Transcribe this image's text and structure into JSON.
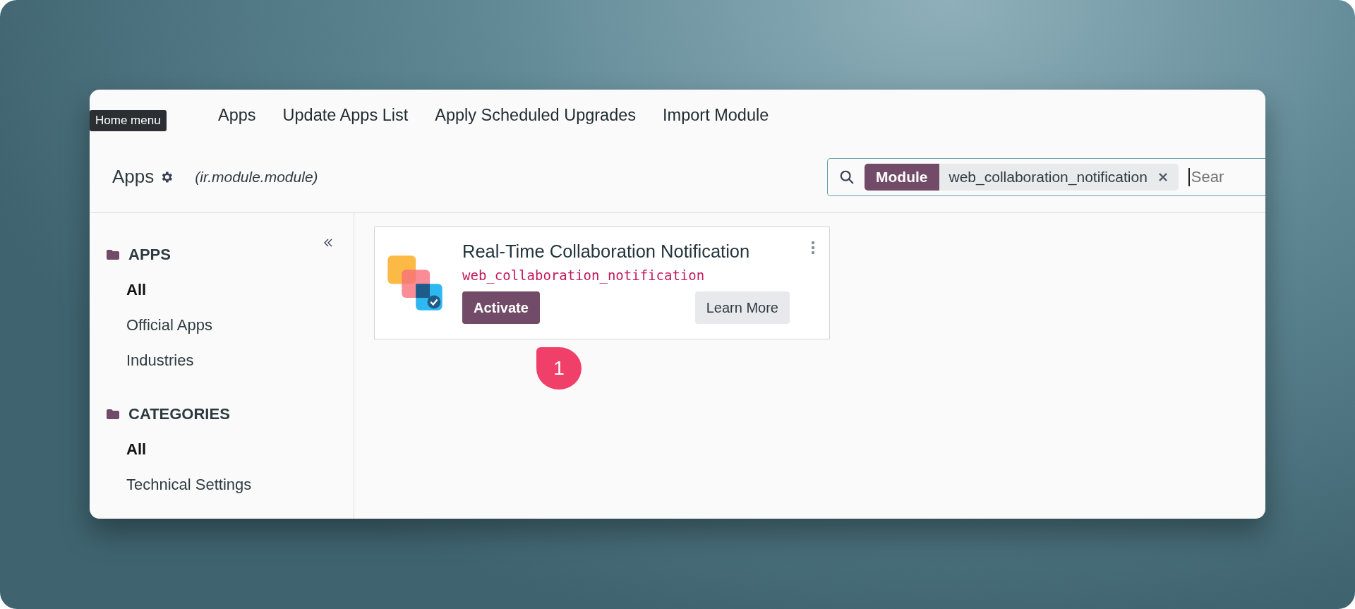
{
  "tooltip": "Home menu",
  "menu": [
    "Apps",
    "Update Apps List",
    "Apply Scheduled Upgrades",
    "Import Module"
  ],
  "breadcrumb": {
    "title": "Apps",
    "model": "(ir.module.module)"
  },
  "search": {
    "facet_label": "Module",
    "facet_value": "web_collaboration_notification",
    "placeholder": "Sear"
  },
  "sidebar": {
    "sections": [
      {
        "title": "APPS",
        "items": [
          {
            "label": "All",
            "selected": true
          },
          {
            "label": "Official Apps",
            "selected": false
          },
          {
            "label": "Industries",
            "selected": false
          }
        ]
      },
      {
        "title": "CATEGORIES",
        "items": [
          {
            "label": "All",
            "selected": true
          },
          {
            "label": "Technical Settings",
            "selected": false
          }
        ]
      }
    ]
  },
  "modules": [
    {
      "name": "Real-Time Collaboration Notification",
      "technical_name": "web_collaboration_notification",
      "buttons": [
        {
          "label": "Activate",
          "kind": "primary"
        },
        {
          "label": "Learn More",
          "kind": "secondary"
        }
      ]
    }
  ],
  "step_marker": "1"
}
